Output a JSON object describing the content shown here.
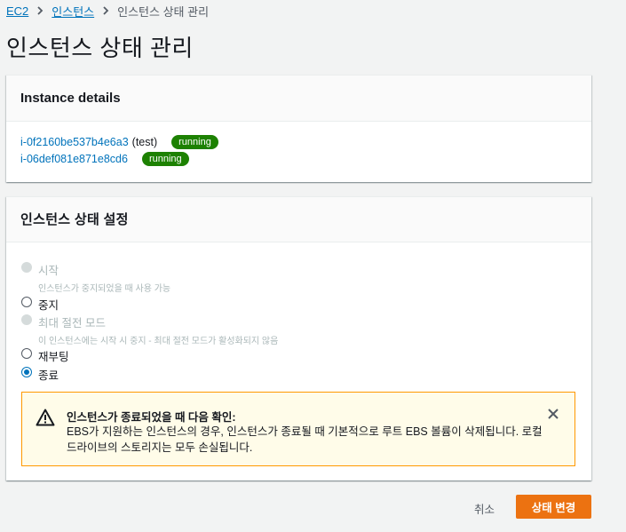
{
  "breadcrumb": {
    "items": [
      "EC2",
      "인스턴스"
    ],
    "current": "인스턴스 상태 관리"
  },
  "page": {
    "title": "인스턴스 상태 관리"
  },
  "instance_details": {
    "title": "Instance details",
    "instances": [
      {
        "id": "i-0f2160be537b4e6a3",
        "name": "(test)",
        "state": "running"
      },
      {
        "id": "i-06def081e871e8cd6",
        "name": "",
        "state": "running"
      }
    ]
  },
  "state_settings": {
    "title": "인스턴스 상태 설정",
    "options": [
      {
        "label": "시작",
        "description": "인스턴스가 중지되었을 때 사용 가능",
        "disabled": true,
        "checked": false
      },
      {
        "label": "중지",
        "description": "",
        "disabled": false,
        "checked": false
      },
      {
        "label": "최대 절전 모드",
        "description": "이 인스턴스에는 시작 시 중지 - 최대 절전 모드가 활성화되지 않음",
        "disabled": true,
        "checked": false
      },
      {
        "label": "재부팅",
        "description": "",
        "disabled": false,
        "checked": false
      },
      {
        "label": "종료",
        "description": "",
        "disabled": false,
        "checked": true
      }
    ],
    "alert": {
      "title": "인스턴스가 종료되었을 때 다음 확인:",
      "body": "EBS가 지원하는 인스턴스의 경우, 인스턴스가 종료될 때 기본적으로 루트 EBS 볼륨이 삭제됩니다. 로컬 드라이브의 스토리지는 모두 손실됩니다.",
      "icon": "warning-icon",
      "color": "#ff9900"
    }
  },
  "actions": {
    "cancel": "취소",
    "submit": "상태 변경"
  },
  "colors": {
    "link": "#0073bb",
    "running_badge": "#1d8102",
    "primary": "#ec7211"
  }
}
